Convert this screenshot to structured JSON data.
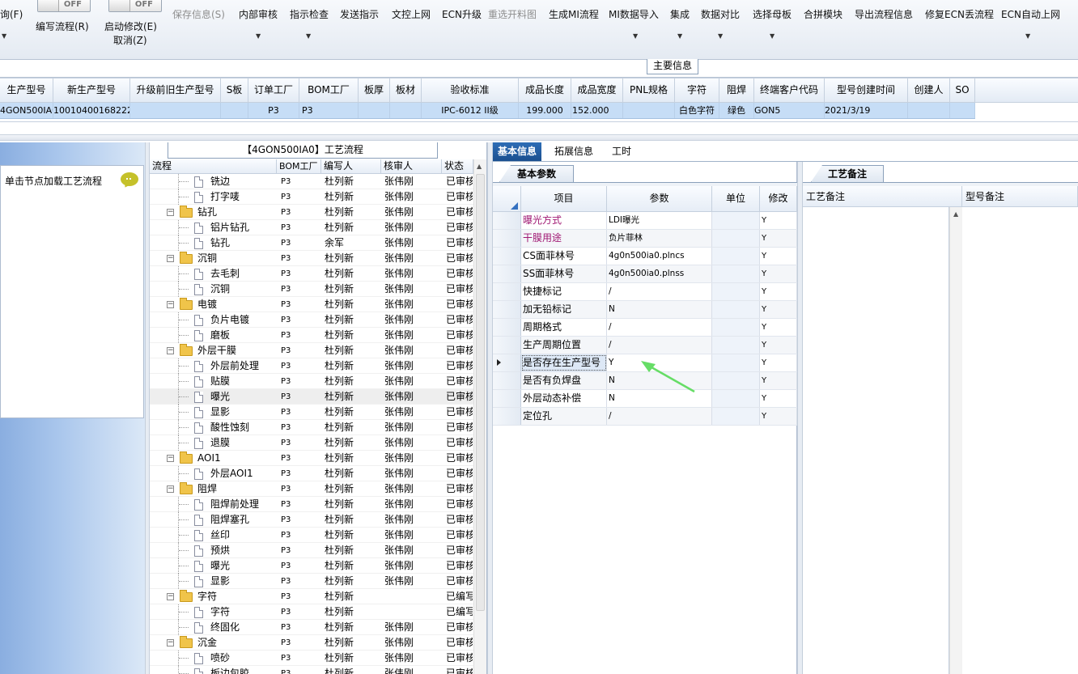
{
  "ribbon": {
    "query_label": "询(F)",
    "toggle_left": "OFF",
    "toggle_right": "OFF",
    "write_flow": "编写流程(R)",
    "start_modify": "启动修改(E)",
    "cancel": "取消(Z)",
    "buttons": [
      {
        "label": "保存信息(S)",
        "disabled": true
      },
      {
        "label": "内部审核",
        "disabled": false
      },
      {
        "label": "指示检查",
        "disabled": false
      },
      {
        "label": "发送指示",
        "disabled": false
      },
      {
        "label": "文控上网",
        "disabled": false
      },
      {
        "label": "ECN升级",
        "disabled": false
      },
      {
        "label": "重选开料图",
        "disabled": true
      },
      {
        "label": "生成MI流程",
        "disabled": false
      },
      {
        "label": "MI数据导入",
        "disabled": false
      },
      {
        "label": "集成",
        "disabled": false
      },
      {
        "label": "数据对比",
        "disabled": false
      },
      {
        "label": "选择母板",
        "disabled": false
      },
      {
        "label": "合拼模块",
        "disabled": false
      },
      {
        "label": "导出流程信息",
        "disabled": false
      },
      {
        "label": "修复ECN丢流程",
        "disabled": false
      },
      {
        "label": "ECN自动上网",
        "disabled": false
      }
    ]
  },
  "main_info_tab": "主要信息",
  "top_grid": {
    "columns": [
      "生产型号",
      "新生产型号",
      "升级前旧生产型号",
      "S板",
      "订单工厂",
      "BOM工厂",
      "板厚",
      "板材",
      "验收标准",
      "成品长度",
      "成品宽度",
      "PNL规格",
      "字符",
      "阻焊",
      "终端客户代码",
      "型号创建时间",
      "创建人",
      "SO"
    ],
    "row": [
      "4GON500IA0",
      "10010400168222",
      "",
      "",
      "P3",
      "P3",
      "",
      "",
      "IPC-6012 II级",
      "199.000",
      "152.000",
      "",
      "白色字符",
      "绿色",
      "GON5",
      "2021/3/19",
      "",
      ""
    ]
  },
  "left_panel": {
    "load_label": "单击节点加载工艺流程"
  },
  "process": {
    "title": "【4GON500IA0】工艺流程",
    "columns": [
      "流程",
      "BOM工厂",
      "编写人",
      "核审人",
      "状态"
    ],
    "rows": [
      {
        "name": "铣边",
        "level": 1,
        "bom": "P3",
        "writer": "杜列新",
        "reviewer": "张伟刚",
        "status": "已审核"
      },
      {
        "name": "打字唛",
        "level": 1,
        "bom": "P3",
        "writer": "杜列新",
        "reviewer": "张伟刚",
        "status": "已审核"
      },
      {
        "name": "钻孔",
        "level": 0,
        "bom": "P3",
        "writer": "杜列新",
        "reviewer": "张伟刚",
        "status": "已审核"
      },
      {
        "name": "铝片钻孔",
        "level": 1,
        "bom": "P3",
        "writer": "杜列新",
        "reviewer": "张伟刚",
        "status": "已审核"
      },
      {
        "name": "钻孔",
        "level": 1,
        "bom": "P3",
        "writer": "余军",
        "reviewer": "张伟刚",
        "status": "已审核"
      },
      {
        "name": "沉铜",
        "level": 0,
        "bom": "P3",
        "writer": "杜列新",
        "reviewer": "张伟刚",
        "status": "已审核"
      },
      {
        "name": "去毛刺",
        "level": 1,
        "bom": "P3",
        "writer": "杜列新",
        "reviewer": "张伟刚",
        "status": "已审核"
      },
      {
        "name": "沉铜",
        "level": 1,
        "bom": "P3",
        "writer": "杜列新",
        "reviewer": "张伟刚",
        "status": "已审核"
      },
      {
        "name": "电镀",
        "level": 0,
        "bom": "P3",
        "writer": "杜列新",
        "reviewer": "张伟刚",
        "status": "已审核"
      },
      {
        "name": "负片电镀",
        "level": 1,
        "bom": "P3",
        "writer": "杜列新",
        "reviewer": "张伟刚",
        "status": "已审核"
      },
      {
        "name": "磨板",
        "level": 1,
        "bom": "P3",
        "writer": "杜列新",
        "reviewer": "张伟刚",
        "status": "已审核"
      },
      {
        "name": "外层干膜",
        "level": 0,
        "bom": "P3",
        "writer": "杜列新",
        "reviewer": "张伟刚",
        "status": "已审核"
      },
      {
        "name": "外层前处理",
        "level": 1,
        "bom": "P3",
        "writer": "杜列新",
        "reviewer": "张伟刚",
        "status": "已审核"
      },
      {
        "name": "贴膜",
        "level": 1,
        "bom": "P3",
        "writer": "杜列新",
        "reviewer": "张伟刚",
        "status": "已审核"
      },
      {
        "name": "曝光",
        "level": 1,
        "bom": "P3",
        "writer": "杜列新",
        "reviewer": "张伟刚",
        "status": "已审核",
        "selected": true
      },
      {
        "name": "显影",
        "level": 1,
        "bom": "P3",
        "writer": "杜列新",
        "reviewer": "张伟刚",
        "status": "已审核"
      },
      {
        "name": "酸性蚀刻",
        "level": 1,
        "bom": "P3",
        "writer": "杜列新",
        "reviewer": "张伟刚",
        "status": "已审核"
      },
      {
        "name": "退膜",
        "level": 1,
        "bom": "P3",
        "writer": "杜列新",
        "reviewer": "张伟刚",
        "status": "已审核"
      },
      {
        "name": "AOI1",
        "level": 0,
        "bom": "P3",
        "writer": "杜列新",
        "reviewer": "张伟刚",
        "status": "已审核"
      },
      {
        "name": "外层AOI1",
        "level": 1,
        "bom": "P3",
        "writer": "杜列新",
        "reviewer": "张伟刚",
        "status": "已审核"
      },
      {
        "name": "阻焊",
        "level": 0,
        "bom": "P3",
        "writer": "杜列新",
        "reviewer": "张伟刚",
        "status": "已审核"
      },
      {
        "name": "阻焊前处理",
        "level": 1,
        "bom": "P3",
        "writer": "杜列新",
        "reviewer": "张伟刚",
        "status": "已审核"
      },
      {
        "name": "阻焊塞孔",
        "level": 1,
        "bom": "P3",
        "writer": "杜列新",
        "reviewer": "张伟刚",
        "status": "已审核"
      },
      {
        "name": "丝印",
        "level": 1,
        "bom": "P3",
        "writer": "杜列新",
        "reviewer": "张伟刚",
        "status": "已审核"
      },
      {
        "name": "预烘",
        "level": 1,
        "bom": "P3",
        "writer": "杜列新",
        "reviewer": "张伟刚",
        "status": "已审核"
      },
      {
        "name": "曝光",
        "level": 1,
        "bom": "P3",
        "writer": "杜列新",
        "reviewer": "张伟刚",
        "status": "已审核"
      },
      {
        "name": "显影",
        "level": 1,
        "bom": "P3",
        "writer": "杜列新",
        "reviewer": "张伟刚",
        "status": "已审核"
      },
      {
        "name": "字符",
        "level": 0,
        "bom": "P3",
        "writer": "杜列新",
        "reviewer": "",
        "status": "已编写"
      },
      {
        "name": "字符",
        "level": 1,
        "bom": "P3",
        "writer": "杜列新",
        "reviewer": "",
        "status": "已编写"
      },
      {
        "name": "终固化",
        "level": 1,
        "bom": "P3",
        "writer": "杜列新",
        "reviewer": "张伟刚",
        "status": "已审核"
      },
      {
        "name": "沉金",
        "level": 0,
        "bom": "P3",
        "writer": "杜列新",
        "reviewer": "张伟刚",
        "status": "已审核"
      },
      {
        "name": "喷砂",
        "level": 1,
        "bom": "P3",
        "writer": "杜列新",
        "reviewer": "张伟刚",
        "status": "已审核"
      },
      {
        "name": "板边包胶",
        "level": 1,
        "bom": "P3",
        "writer": "杜列新",
        "reviewer": "张伟刚",
        "status": "已审核"
      }
    ]
  },
  "tabs": [
    "基本信息",
    "拓展信息",
    "工时"
  ],
  "params": {
    "tab": "基本参数",
    "columns": [
      "项目",
      "参数",
      "单位",
      "修改"
    ],
    "rows": [
      {
        "item": "曝光方式",
        "value": "LDI曝光",
        "unit": "",
        "mod": "Y",
        "highlight": true
      },
      {
        "item": "干膜用途",
        "value": "负片菲林",
        "unit": "",
        "mod": "Y",
        "highlight": true
      },
      {
        "item": "CS面菲林号",
        "value": "4g0n500ia0.plncs",
        "unit": "",
        "mod": "Y"
      },
      {
        "item": "SS面菲林号",
        "value": "4g0n500ia0.plnss",
        "unit": "",
        "mod": "Y"
      },
      {
        "item": "快捷标记",
        "value": "/",
        "unit": "",
        "mod": "Y"
      },
      {
        "item": "加无铅标记",
        "value": "N",
        "unit": "",
        "mod": "Y"
      },
      {
        "item": "周期格式",
        "value": "/",
        "unit": "",
        "mod": "Y"
      },
      {
        "item": "生产周期位置",
        "value": "/",
        "unit": "",
        "mod": "Y"
      },
      {
        "item": "是否存在生产型号",
        "value": "Y",
        "unit": "",
        "mod": "Y",
        "current": true
      },
      {
        "item": "是否有负焊盘",
        "value": "N",
        "unit": "",
        "mod": "Y"
      },
      {
        "item": "外层动态补偿",
        "value": "N",
        "unit": "",
        "mod": "Y"
      },
      {
        "item": "定位孔",
        "value": "/",
        "unit": "",
        "mod": "Y"
      }
    ]
  },
  "notes": {
    "tab": "工艺备注",
    "col1": "工艺备注",
    "col2": "型号备注"
  },
  "colors": {
    "accent": "#1a4f8f",
    "row_highlight": "#c6ddf6",
    "item_magenta": "#a01873",
    "arrow": "#66dd66"
  }
}
